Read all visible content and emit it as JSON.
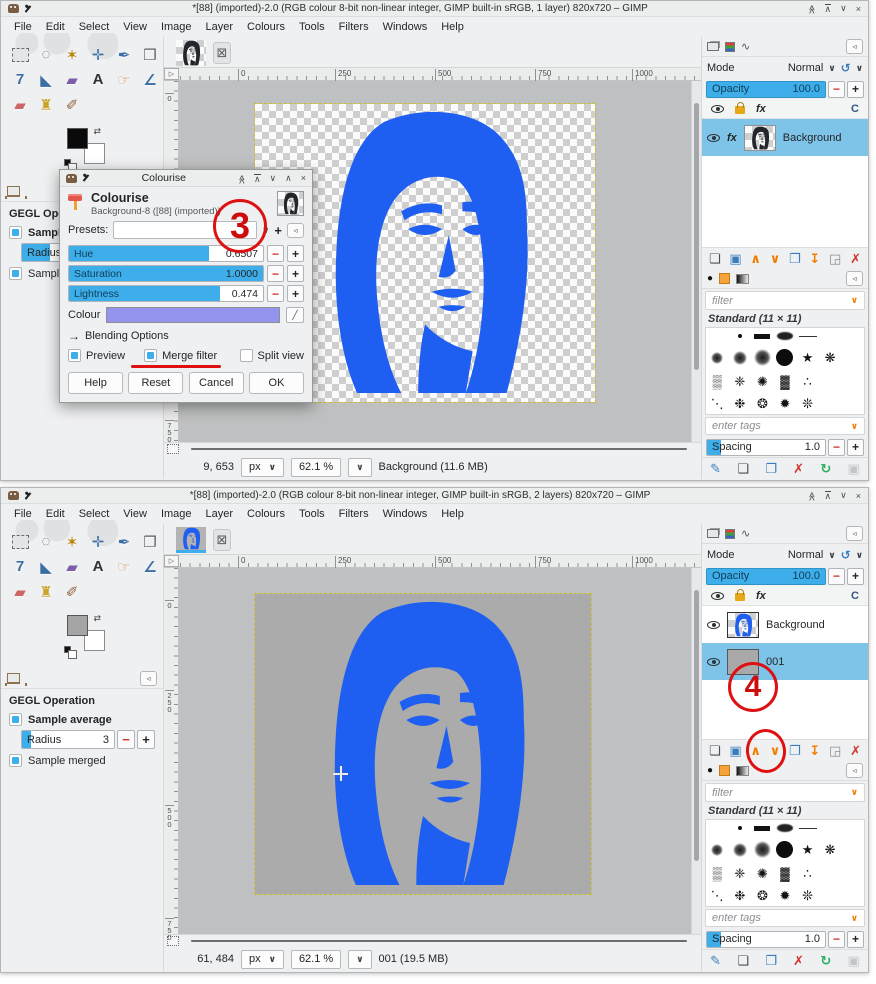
{
  "icons": {
    "chevron_down": "∨",
    "chevron_up": "∧",
    "close": "×",
    "shade": "≪",
    "collapse_left": "◃",
    "undo": "↺",
    "plus": "+",
    "minus": "−",
    "corner_triangle": "▷",
    "wilber_tab": "⊠",
    "arrow_right": "→",
    "paths_wave": "∿",
    "picker": "╱"
  },
  "menu_items": [
    "File",
    "Edit",
    "Select",
    "View",
    "Image",
    "Layer",
    "Colours",
    "Tools",
    "Filters",
    "Windows",
    "Help"
  ],
  "toolbox_tools": [
    {
      "name": "rectangle-select-tool",
      "glyph": "",
      "css": "dashedbox",
      "color": "#6a6e72"
    },
    {
      "name": "free-select-tool",
      "glyph": "◌",
      "color": "#5a5f63"
    },
    {
      "name": "fuzzy-select-tool",
      "glyph": "✶",
      "color": "#b8860b"
    },
    {
      "name": "move-tool",
      "glyph": "✛",
      "color": "#3b6ea5"
    },
    {
      "name": "paths-tool",
      "glyph": "✒",
      "color": "#3b6ea5"
    },
    {
      "name": "crop-tool",
      "glyph": "❒",
      "color": "#5a5f63"
    },
    {
      "name": "unified-transform-tool",
      "glyph": "7",
      "color": "#3b6ea5"
    },
    {
      "name": "bucket-fill-tool",
      "glyph": "◣",
      "color": "#3b6ea5"
    },
    {
      "name": "gradient-tool",
      "glyph": "▰",
      "color": "#7c5fa8"
    },
    {
      "name": "text-tool",
      "glyph": "A",
      "color": "#2f3336"
    },
    {
      "name": "smudge-tool",
      "glyph": "☞",
      "color": "#d9a066"
    },
    {
      "name": "measure-tool",
      "glyph": "∠",
      "color": "#3b6ea5"
    },
    {
      "name": "eraser-tool",
      "glyph": "▰",
      "color": "#cc6666"
    },
    {
      "name": "clone-tool",
      "glyph": "♜",
      "color": "#c9a227"
    },
    {
      "name": "paintbrush-tool",
      "glyph": "✐",
      "color": "#8b5e3c"
    }
  ],
  "hruler_labels": [
    "0",
    "250",
    "500",
    "750",
    "1000"
  ],
  "vruler_labels": [
    "0",
    "250",
    "500",
    "750"
  ],
  "window1": {
    "title": "*[88] (imported)-2.0 (RGB colour 8-bit non-linear integer, GIMP built-in sRGB, 1 layer) 820x720 – GIMP",
    "fg_color": "#0a0a0a",
    "radius_fill": 30,
    "status": {
      "position": "9, 653",
      "unit": "px",
      "zoom": "62.1 %",
      "message": "Background (11.6 MB)"
    },
    "layers": [
      {
        "name": "Background",
        "selected": true,
        "fx": true,
        "thumb": "portrait-dark"
      }
    ]
  },
  "window2": {
    "title": "*[88] (imported)-2.0 (RGB colour 8-bit non-linear integer, GIMP built-in sRGB, 2 layers) 820x720 – GIMP",
    "fg_color": "#a5a5a5",
    "radius_fill": 10,
    "status": {
      "position": "61, 484",
      "unit": "px",
      "zoom": "62.1 %",
      "message": "001 (19.5 MB)"
    },
    "layers": [
      {
        "name": "Background",
        "selected": false,
        "fx": false,
        "thumb": "portrait-blue"
      },
      {
        "name": "001",
        "selected": true,
        "fx": false,
        "thumb": "gray"
      }
    ]
  },
  "tool_options": {
    "header": "GEGL Operation",
    "sample_average": "Sample average",
    "radius_label": "Radius",
    "radius_value": "3",
    "sample_merged": "Sample merged"
  },
  "layers_panel": {
    "mode_label": "Mode",
    "mode_value": "Normal",
    "opacity_label": "Opacity",
    "opacity_value": "100.0",
    "fx_label": "fx",
    "header_partial": "C"
  },
  "layer_toolbar": [
    {
      "name": "new-layer-button",
      "glyph": "❏",
      "color": "#4a4f53"
    },
    {
      "name": "new-group-button",
      "glyph": "▣",
      "color": "#3b7bbf"
    },
    {
      "name": "raise-layer-button",
      "glyph": "∧",
      "color": "#f07d00"
    },
    {
      "name": "lower-layer-button",
      "glyph": "∨",
      "color": "#f07d00"
    },
    {
      "name": "duplicate-layer-button",
      "glyph": "❐",
      "color": "#3b7bbf"
    },
    {
      "name": "merge-down-button",
      "glyph": "↧",
      "color": "#f07d00"
    },
    {
      "name": "layer-mask-button",
      "glyph": "◲",
      "color": "#8a8d8f"
    },
    {
      "name": "delete-layer-button",
      "glyph": "✗",
      "color": "#d0342c"
    }
  ],
  "brush_toolbar": [
    {
      "name": "edit-brush-button",
      "glyph": "✎",
      "color": "#3b7bbf"
    },
    {
      "name": "new-brush-button",
      "glyph": "❏",
      "color": "#4a4f53"
    },
    {
      "name": "duplicate-brush-button",
      "glyph": "❐",
      "color": "#3b7bbf"
    },
    {
      "name": "delete-brush-button",
      "glyph": "✗",
      "color": "#d0342c"
    },
    {
      "name": "refresh-brushes-button",
      "glyph": "↻",
      "color": "#27ae60"
    },
    {
      "name": "open-brush-button",
      "glyph": "▣",
      "color": "#c3c5c7"
    }
  ],
  "brushes_panel": {
    "filter_placeholder": "filter",
    "group_label": "Standard (11 × 11)",
    "tags_placeholder": "enter tags",
    "spacing_label": "Spacing",
    "spacing_value": "1.0",
    "spacing_fill": 12,
    "thumbs": [
      "empty",
      "dot",
      "bar",
      "ellipse",
      "line",
      "empty",
      "empty",
      "fuzzy-sm",
      "fuzzy-md",
      "fuzzy-lg",
      "disc",
      "g:★",
      "g:❋",
      "empty",
      "g:▒",
      "g:❈",
      "g:✺",
      "g:▓",
      "g:∴",
      "empty",
      "empty",
      "g:⋱",
      "g:❉",
      "g:❂",
      "g:✹",
      "g:❊",
      "empty",
      "empty"
    ]
  },
  "dialog": {
    "title": "Colourise",
    "heading": "Colourise",
    "subtitle": "Background-8 ([88] (imported))",
    "presets_label": "Presets:",
    "sliders": [
      {
        "label": "Hue",
        "value": "0.6507",
        "fill": 72
      },
      {
        "label": "Saturation",
        "value": "1.0000",
        "fill": 100
      },
      {
        "label": "Lightness",
        "value": "0.474",
        "fill": 78
      }
    ],
    "colour_label": "Colour",
    "colour_value": "#9494ee",
    "blending_label": "Blending Options",
    "preview_label": "Preview",
    "merge_filter_label": "Merge filter",
    "split_view_label": "Split view",
    "buttons": [
      "Help",
      "Reset",
      "Cancel",
      "OK"
    ]
  },
  "annotations": {
    "step3": "3",
    "step4": "4"
  },
  "colors": {
    "accent": "#3daee9",
    "portrait_blue": "#1e5ef0",
    "canvas_gray": "#ababab",
    "annotation_red": "#dd1111"
  }
}
